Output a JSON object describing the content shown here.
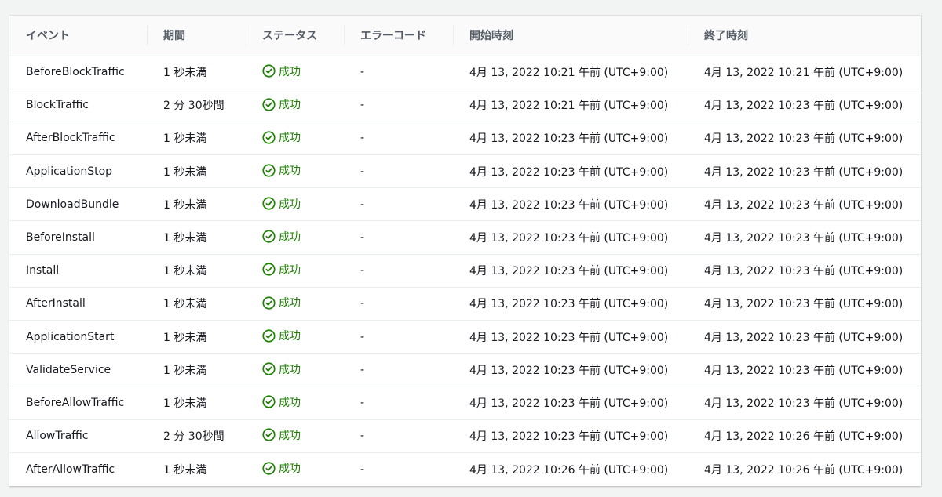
{
  "colors": {
    "success": "#1d8102",
    "header_text": "#545b64",
    "border": "#eaeded"
  },
  "table": {
    "columns": [
      "イベント",
      "期間",
      "ステータス",
      "エラーコード",
      "開始時刻",
      "終了時刻"
    ],
    "status_icon": "check-circle-icon",
    "rows": [
      {
        "event": "BeforeBlockTraffic",
        "duration": "1 秒未満",
        "status": "成功",
        "error_code": "-",
        "start_time": "4月 13, 2022 10:21 午前 (UTC+9:00)",
        "end_time": "4月 13, 2022 10:21 午前 (UTC+9:00)"
      },
      {
        "event": "BlockTraffic",
        "duration": "2 分 30秒間",
        "status": "成功",
        "error_code": "-",
        "start_time": "4月 13, 2022 10:21 午前 (UTC+9:00)",
        "end_time": "4月 13, 2022 10:23 午前 (UTC+9:00)"
      },
      {
        "event": "AfterBlockTraffic",
        "duration": "1 秒未満",
        "status": "成功",
        "error_code": "-",
        "start_time": "4月 13, 2022 10:23 午前 (UTC+9:00)",
        "end_time": "4月 13, 2022 10:23 午前 (UTC+9:00)"
      },
      {
        "event": "ApplicationStop",
        "duration": "1 秒未満",
        "status": "成功",
        "error_code": "-",
        "start_time": "4月 13, 2022 10:23 午前 (UTC+9:00)",
        "end_time": "4月 13, 2022 10:23 午前 (UTC+9:00)"
      },
      {
        "event": "DownloadBundle",
        "duration": "1 秒未満",
        "status": "成功",
        "error_code": "-",
        "start_time": "4月 13, 2022 10:23 午前 (UTC+9:00)",
        "end_time": "4月 13, 2022 10:23 午前 (UTC+9:00)"
      },
      {
        "event": "BeforeInstall",
        "duration": "1 秒未満",
        "status": "成功",
        "error_code": "-",
        "start_time": "4月 13, 2022 10:23 午前 (UTC+9:00)",
        "end_time": "4月 13, 2022 10:23 午前 (UTC+9:00)"
      },
      {
        "event": "Install",
        "duration": "1 秒未満",
        "status": "成功",
        "error_code": "-",
        "start_time": "4月 13, 2022 10:23 午前 (UTC+9:00)",
        "end_time": "4月 13, 2022 10:23 午前 (UTC+9:00)"
      },
      {
        "event": "AfterInstall",
        "duration": "1 秒未満",
        "status": "成功",
        "error_code": "-",
        "start_time": "4月 13, 2022 10:23 午前 (UTC+9:00)",
        "end_time": "4月 13, 2022 10:23 午前 (UTC+9:00)"
      },
      {
        "event": "ApplicationStart",
        "duration": "1 秒未満",
        "status": "成功",
        "error_code": "-",
        "start_time": "4月 13, 2022 10:23 午前 (UTC+9:00)",
        "end_time": "4月 13, 2022 10:23 午前 (UTC+9:00)"
      },
      {
        "event": "ValidateService",
        "duration": "1 秒未満",
        "status": "成功",
        "error_code": "-",
        "start_time": "4月 13, 2022 10:23 午前 (UTC+9:00)",
        "end_time": "4月 13, 2022 10:23 午前 (UTC+9:00)"
      },
      {
        "event": "BeforeAllowTraffic",
        "duration": "1 秒未満",
        "status": "成功",
        "error_code": "-",
        "start_time": "4月 13, 2022 10:23 午前 (UTC+9:00)",
        "end_time": "4月 13, 2022 10:23 午前 (UTC+9:00)"
      },
      {
        "event": "AllowTraffic",
        "duration": "2 分 30秒間",
        "status": "成功",
        "error_code": "-",
        "start_time": "4月 13, 2022 10:23 午前 (UTC+9:00)",
        "end_time": "4月 13, 2022 10:26 午前 (UTC+9:00)"
      },
      {
        "event": "AfterAllowTraffic",
        "duration": "1 秒未満",
        "status": "成功",
        "error_code": "-",
        "start_time": "4月 13, 2022 10:26 午前 (UTC+9:00)",
        "end_time": "4月 13, 2022 10:26 午前 (UTC+9:00)"
      }
    ]
  }
}
